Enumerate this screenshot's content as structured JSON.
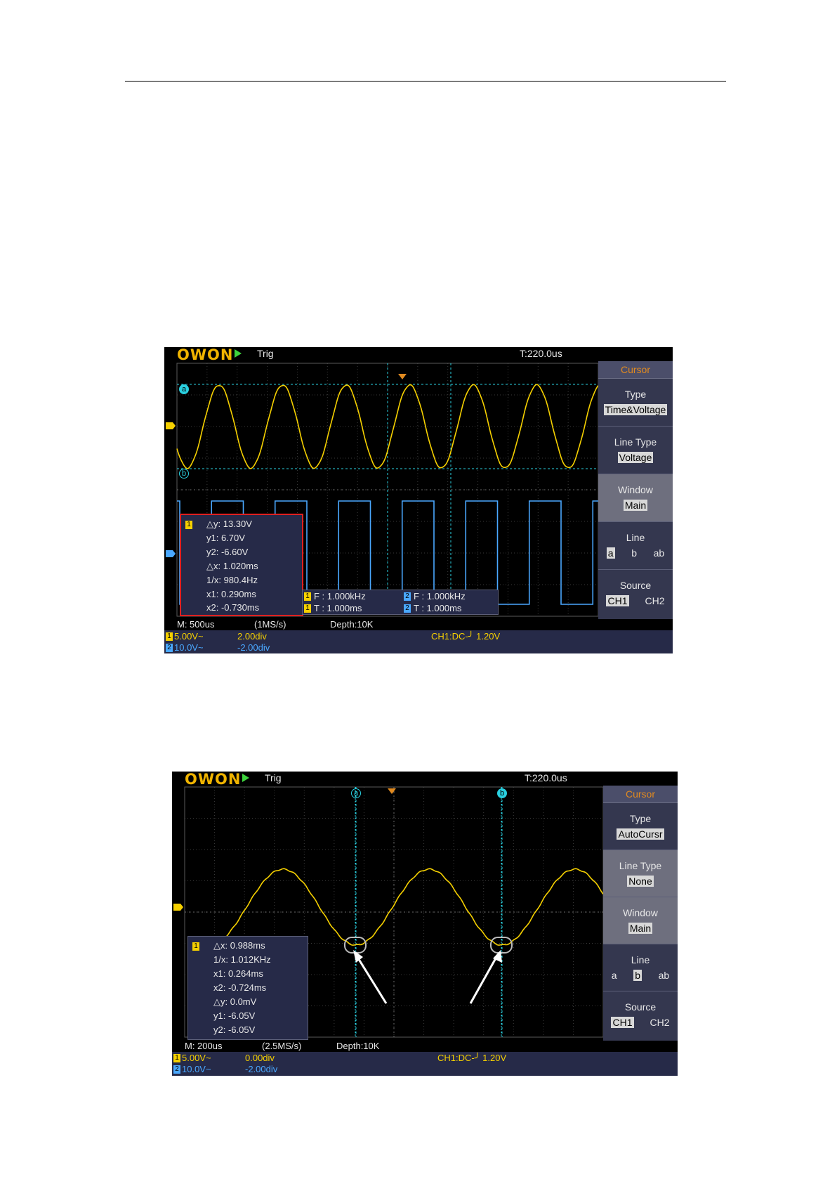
{
  "brand": "OWON",
  "screens": [
    {
      "trigger_status": "Trig",
      "time_offset": "T:220.0us",
      "cursor_menu": {
        "title": "Cursor",
        "type_label": "Type",
        "type_value": "Time&Voltage",
        "line_type_label": "Line Type",
        "line_type_value": "Voltage",
        "window_label": "Window",
        "window_value": "Main",
        "line_label": "Line",
        "line_options": [
          "a",
          "b",
          "ab"
        ],
        "source_label": "Source",
        "source_options": [
          "CH1",
          "CH2"
        ]
      },
      "cursor_tags": [
        "a",
        "b"
      ],
      "measure_panel": {
        "channel": "1",
        "rows": [
          "△y: 13.30V",
          "y1: 6.70V",
          "y2: -6.60V",
          "△x: 1.020ms",
          "1/x: 980.4Hz",
          "x1: 0.290ms",
          "x2: -0.730ms"
        ]
      },
      "freq_box": {
        "ch1_freq": "F : 1.000kHz",
        "ch2_freq": "F : 1.000kHz",
        "ch1_period": "T : 1.000ms",
        "ch2_period": "T : 1.000ms",
        "ch1": "1",
        "ch2": "2"
      },
      "status": {
        "timebase": "M: 500us",
        "sample_rate": "(1MS/s)",
        "depth": "Depth:10K"
      },
      "channels": {
        "ch1_num": "1",
        "ch1_scale": "5.00V~",
        "ch1_offset": "2.00div",
        "ch2_num": "2",
        "ch2_scale": "10.0V~",
        "ch2_offset": "-2.00div",
        "trigger": "CH1:DC-╯ 1.20V"
      }
    },
    {
      "trigger_status": "Trig",
      "time_offset": "T:220.0us",
      "cursor_menu": {
        "title": "Cursor",
        "type_label": "Type",
        "type_value": "AutoCursr",
        "line_type_label": "Line Type",
        "line_type_value": "None",
        "window_label": "Window",
        "window_value": "Main",
        "line_label": "Line",
        "line_options": [
          "a",
          "b",
          "ab"
        ],
        "source_label": "Source",
        "source_options": [
          "CH1",
          "CH2"
        ]
      },
      "cursor_tags": [
        "a",
        "b"
      ],
      "measure_panel": {
        "channel": "1",
        "rows": [
          "△x: 0.988ms",
          "1/x: 1.012KHz",
          "x1: 0.264ms",
          "x2: -0.724ms",
          "△y: 0.0mV",
          "y1: -6.05V",
          "y2: -6.05V"
        ]
      },
      "status": {
        "timebase": "M: 200us",
        "sample_rate": "(2.5MS/s)",
        "depth": "Depth:10K"
      },
      "channels": {
        "ch1_num": "1",
        "ch1_scale": "5.00V~",
        "ch1_offset": "0.00div",
        "ch2_num": "2",
        "ch2_scale": "10.0V~",
        "ch2_offset": "-2.00div",
        "trigger": "CH1:DC-╯ 1.20V"
      }
    }
  ],
  "colors": {
    "ch1": "#f5d000",
    "ch2": "#4aa8ff",
    "cursor": "#2ad0e0",
    "panel": "#262a48",
    "menu_accent": "#e08a20"
  }
}
